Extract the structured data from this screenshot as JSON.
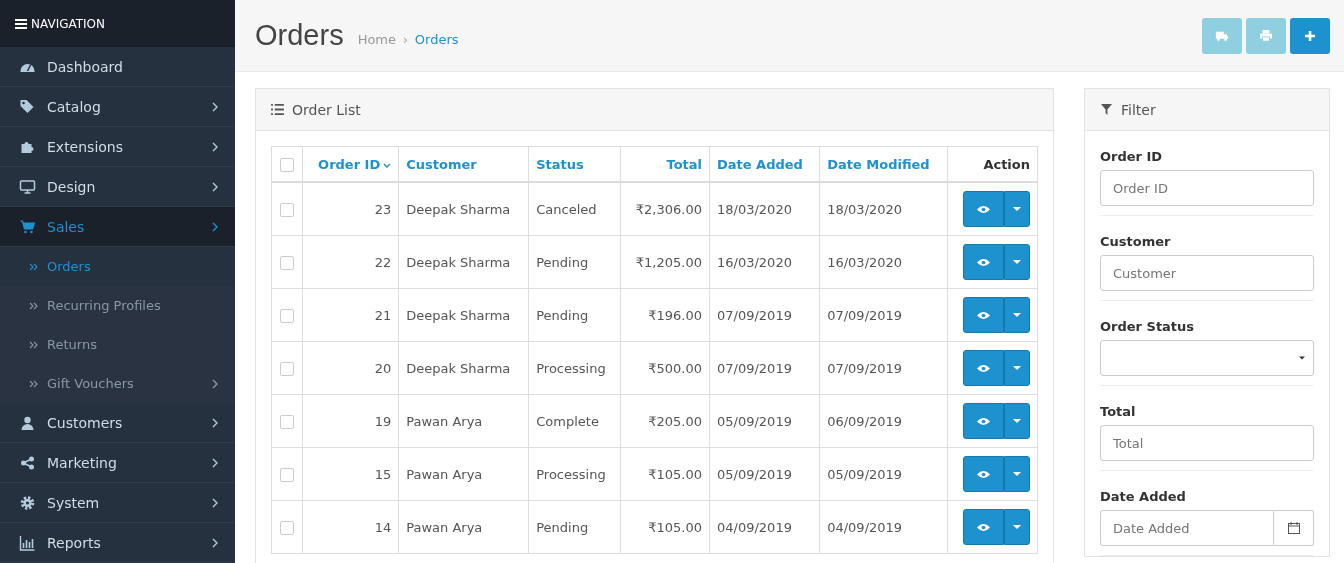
{
  "sidebar": {
    "title": "NAVIGATION",
    "items": [
      {
        "kind": "dashboard",
        "label": "Dashboard",
        "has_submenu": false,
        "selected": false
      },
      {
        "kind": "tag",
        "label": "Catalog",
        "has_submenu": true,
        "selected": false
      },
      {
        "kind": "puzzle",
        "label": "Extensions",
        "has_submenu": true,
        "selected": false
      },
      {
        "kind": "monitor",
        "label": "Design",
        "has_submenu": true,
        "selected": false
      },
      {
        "kind": "cart",
        "label": "Sales",
        "has_submenu": true,
        "selected": true,
        "children": [
          {
            "label": "Orders",
            "selected": true,
            "has_submenu": false
          },
          {
            "label": "Recurring Profiles",
            "selected": false,
            "has_submenu": false
          },
          {
            "label": "Returns",
            "selected": false,
            "has_submenu": false
          },
          {
            "label": "Gift Vouchers",
            "selected": false,
            "has_submenu": true
          }
        ]
      },
      {
        "kind": "user",
        "label": "Customers",
        "has_submenu": true,
        "selected": false
      },
      {
        "kind": "share",
        "label": "Marketing",
        "has_submenu": true,
        "selected": false
      },
      {
        "kind": "gear",
        "label": "System",
        "has_submenu": true,
        "selected": false
      },
      {
        "kind": "chart",
        "label": "Reports",
        "has_submenu": true,
        "selected": false
      }
    ]
  },
  "header": {
    "title": "Orders",
    "breadcrumb": [
      {
        "label": "Home",
        "selected": false
      },
      {
        "label": "Orders",
        "selected": true
      }
    ],
    "breadcrumb_separator": "›",
    "buttons": [
      {
        "kind": "truck"
      },
      {
        "kind": "print"
      },
      {
        "kind": "plus"
      }
    ]
  },
  "order_list": {
    "title": "Order List",
    "columns": [
      {
        "label": "Order ID",
        "sorted": true
      },
      {
        "label": "Customer",
        "sorted": false
      },
      {
        "label": "Status",
        "sorted": false
      },
      {
        "label": "Total",
        "sorted": false
      },
      {
        "label": "Date Added",
        "sorted": false
      },
      {
        "label": "Date Modified",
        "sorted": false
      },
      {
        "label": "Action",
        "sorted": false
      }
    ],
    "select_all_checked": false,
    "rows": [
      {
        "checked": false,
        "cells": [
          "23",
          "Deepak Sharma",
          "Canceled",
          "₹2,306.00",
          "18/03/2020",
          "18/03/2020"
        ]
      },
      {
        "checked": false,
        "cells": [
          "22",
          "Deepak Sharma",
          "Pending",
          "₹1,205.00",
          "16/03/2020",
          "16/03/2020"
        ]
      },
      {
        "checked": false,
        "cells": [
          "21",
          "Deepak Sharma",
          "Pending",
          "₹196.00",
          "07/09/2019",
          "07/09/2019"
        ]
      },
      {
        "checked": false,
        "cells": [
          "20",
          "Deepak Sharma",
          "Processing",
          "₹500.00",
          "07/09/2019",
          "07/09/2019"
        ]
      },
      {
        "checked": false,
        "cells": [
          "19",
          "Pawan Arya",
          "Complete",
          "₹205.00",
          "05/09/2019",
          "06/09/2019"
        ]
      },
      {
        "checked": false,
        "cells": [
          "15",
          "Pawan Arya",
          "Processing",
          "₹105.00",
          "05/09/2019",
          "05/09/2019"
        ]
      },
      {
        "checked": false,
        "cells": [
          "14",
          "Pawan Arya",
          "Pending",
          "₹105.00",
          "04/09/2019",
          "04/09/2019"
        ]
      }
    ]
  },
  "filter": {
    "title": "Filter",
    "fields": [
      {
        "kind": "text",
        "label": "Order ID",
        "placeholder": "Order ID"
      },
      {
        "kind": "text",
        "label": "Customer",
        "placeholder": "Customer"
      },
      {
        "kind": "select",
        "label": "Order Status"
      },
      {
        "kind": "text",
        "label": "Total",
        "placeholder": "Total"
      },
      {
        "kind": "date",
        "label": "Date Added",
        "placeholder": "Date Added"
      }
    ]
  }
}
